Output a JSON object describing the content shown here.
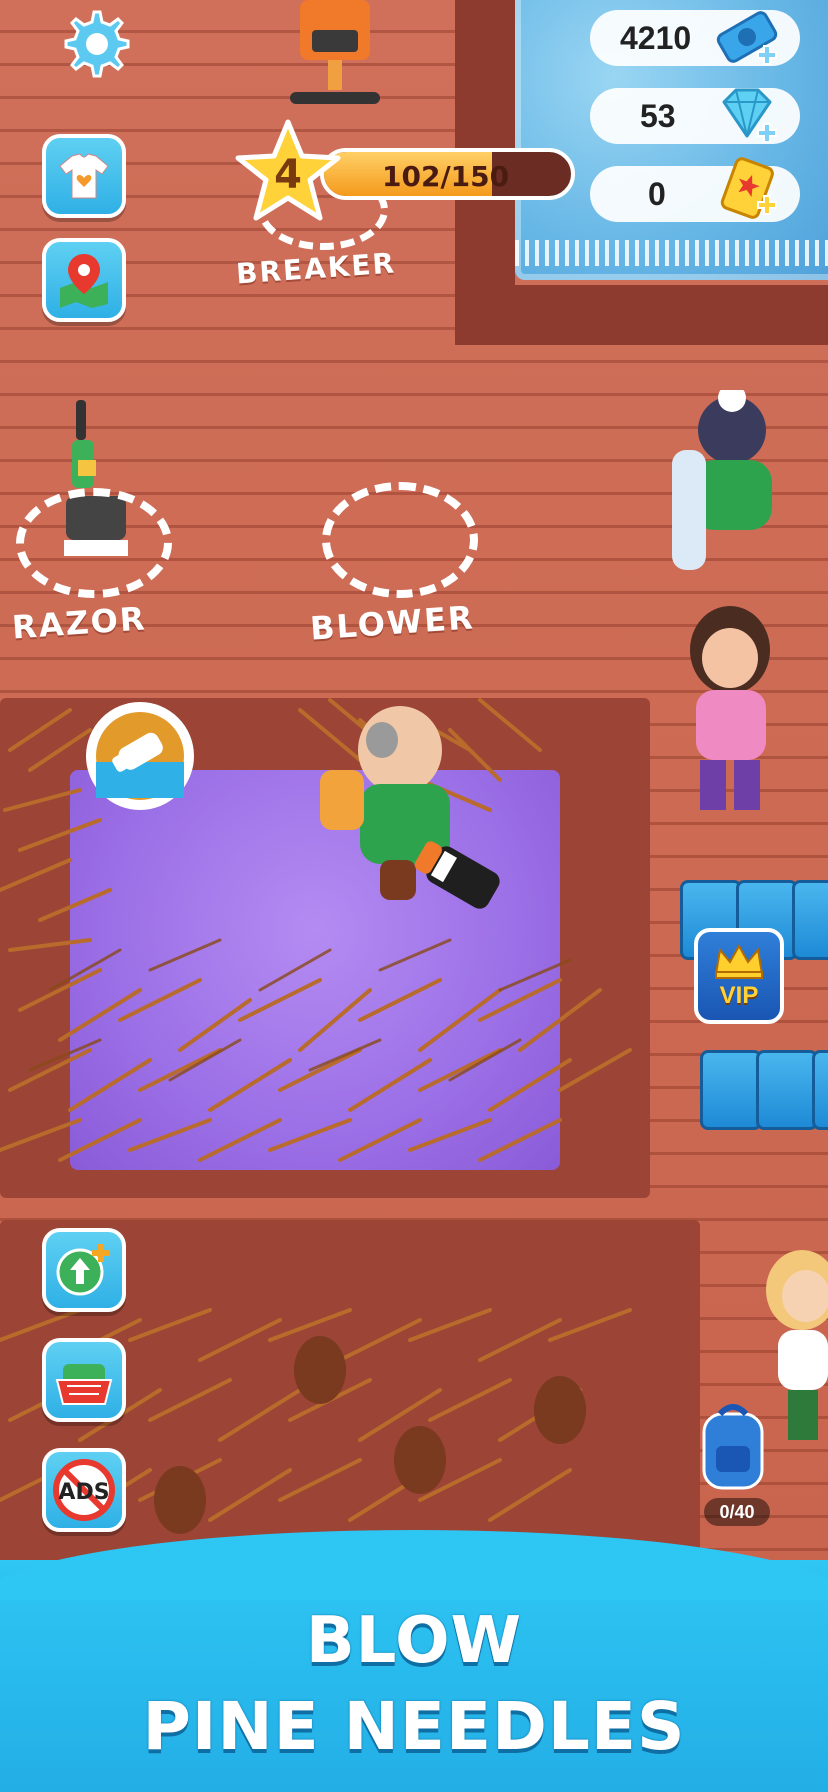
{
  "hud": {
    "settings_icon": "gear-icon",
    "currencies": [
      {
        "name": "cash",
        "value": "4210",
        "icon": "cash-stack-icon"
      },
      {
        "name": "gems",
        "value": "53",
        "icon": "diamond-icon"
      },
      {
        "name": "tickets",
        "value": "0",
        "icon": "ticket-icon"
      }
    ],
    "level": {
      "number": "4",
      "progress_text": "102/150",
      "progress": 0.68
    },
    "left_buttons": [
      {
        "name": "outfit",
        "icon": "tshirt-icon"
      },
      {
        "name": "map",
        "icon": "map-pin-icon"
      }
    ],
    "bottom_buttons": [
      {
        "name": "upgrade",
        "icon": "up-arrow-plus-icon"
      },
      {
        "name": "shop",
        "icon": "basket-icon"
      },
      {
        "name": "no-ads",
        "icon": "no-ads-icon",
        "label": "ADS"
      }
    ]
  },
  "stations": {
    "breaker": "BREAKER",
    "razor": "RAZOR",
    "blower": "BLOWER"
  },
  "vip": {
    "label": "VIP",
    "icon": "crown-icon"
  },
  "backpack": {
    "icon": "backpack-icon",
    "count": "0/40"
  },
  "banner": {
    "line1": "BLOW",
    "line2": "PINE NEEDLES"
  },
  "colors": {
    "accent": "#2fb0e6",
    "floor": "#c9634b",
    "carpet": "#9b6fe6",
    "needles": "#b86b2a"
  }
}
